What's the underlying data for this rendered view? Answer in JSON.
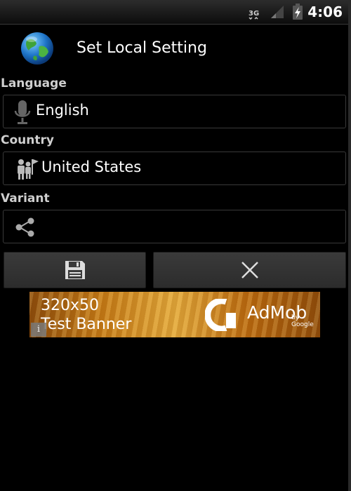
{
  "status_bar": {
    "network_label": "3G",
    "time": "4:06",
    "icons": [
      "3g-data-icon",
      "signal-icon",
      "battery-charging-icon"
    ]
  },
  "header": {
    "title": "Set Local Setting",
    "icon": "globe-icon"
  },
  "form": {
    "language": {
      "label": "Language",
      "value": "English",
      "icon": "microphone-icon"
    },
    "country": {
      "label": "Country",
      "value": "United States",
      "icon": "people-flag-icon"
    },
    "variant": {
      "label": "Variant",
      "value": "",
      "icon": "share-icon"
    }
  },
  "actions": {
    "save_icon": "save-floppy-icon",
    "cancel_icon": "close-icon"
  },
  "ad": {
    "size_text": "320x50",
    "banner_text": "Test Banner",
    "brand": "AdMob",
    "brand_suffix": "by Google",
    "info_glyph": "i",
    "colors": {
      "gold": "#e2a93c",
      "bronze": "#8a4b0c"
    }
  }
}
